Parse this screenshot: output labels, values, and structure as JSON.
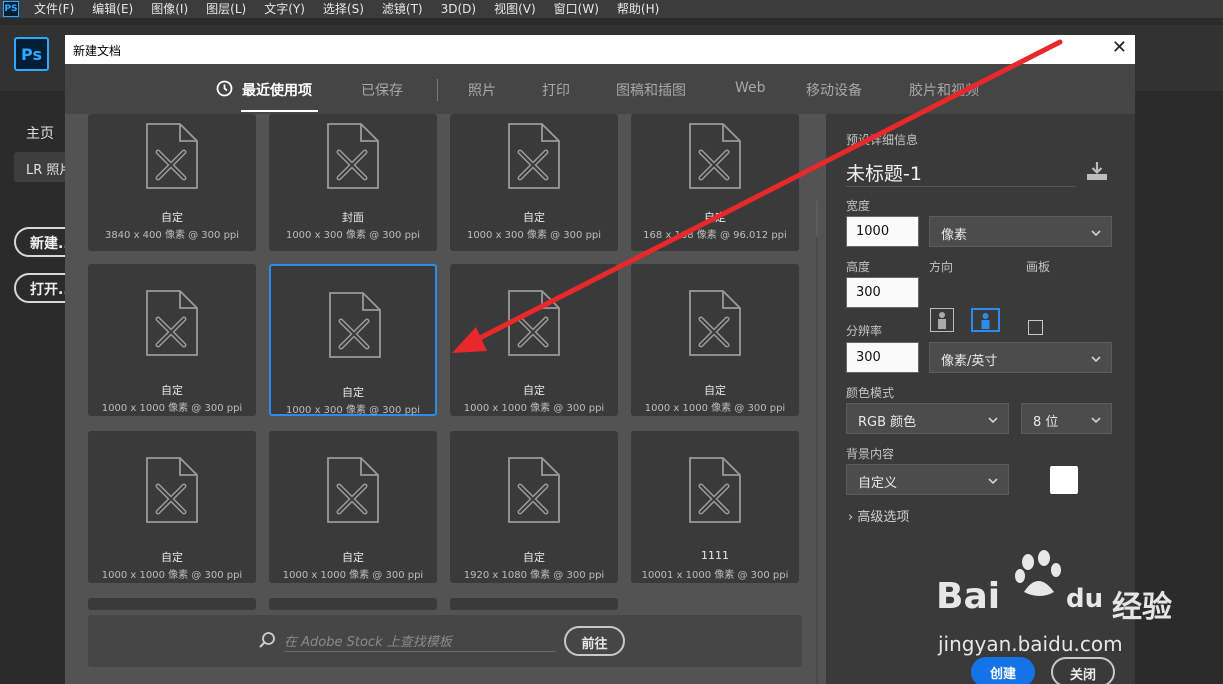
{
  "menubar": {
    "app_icon": "PS",
    "items": [
      "文件(F)",
      "编辑(E)",
      "图像(I)",
      "图层(L)",
      "文字(Y)",
      "选择(S)",
      "滤镜(T)",
      "3D(D)",
      "视图(V)",
      "窗口(W)",
      "帮助(H)"
    ]
  },
  "home": {
    "logo": "Ps",
    "nav_home": "主页",
    "nav_lr": "LR 照片",
    "new_button": "新建...",
    "open_button": "打开..."
  },
  "dialog": {
    "title": "新建文档",
    "close_glyph": "✕",
    "tabs": [
      "最近使用项",
      "已保存",
      "照片",
      "打印",
      "图稿和插图",
      "Web",
      "移动设备",
      "胶片和视频"
    ],
    "active_tab": 0,
    "cards": [
      {
        "name": "自定",
        "dims": "3840 x 400 像素 @ 300 ppi"
      },
      {
        "name": "封面",
        "dims": "1000 x 300 像素 @ 300 ppi"
      },
      {
        "name": "自定",
        "dims": "1000 x 300 像素 @ 300 ppi"
      },
      {
        "name": "自定",
        "dims": "168 x 168 像素 @ 96.012 ppi"
      },
      {
        "name": "自定",
        "dims": "1000 x 1000 像素 @ 300 ppi"
      },
      {
        "name": "自定",
        "dims": "1000 x 300 像素 @ 300 ppi"
      },
      {
        "name": "自定",
        "dims": "1000 x 1000 像素 @ 300 ppi"
      },
      {
        "name": "自定",
        "dims": "1000 x 1000 像素 @ 300 ppi"
      },
      {
        "name": "自定",
        "dims": "1000 x 1000 像素 @ 300 ppi"
      },
      {
        "name": "自定",
        "dims": "1000 x 1000 像素 @ 300 ppi"
      },
      {
        "name": "自定",
        "dims": "1920 x 1080 像素 @ 300 ppi"
      },
      {
        "name": "1111",
        "dims": "10001 x 1000 像素 @ 300 ppi"
      }
    ],
    "selected_card": 5,
    "stock": {
      "placeholder": "在 Adobe Stock 上查找模板",
      "go_button": "前往"
    },
    "preset": {
      "section_label": "预设详细信息",
      "doc_name": "未标题-1",
      "width_label": "宽度",
      "width_value": "1000",
      "width_unit": "像素",
      "height_label": "高度",
      "height_value": "300",
      "orientation_label": "方向",
      "artboard_label": "画板",
      "resolution_label": "分辨率",
      "resolution_value": "300",
      "resolution_unit": "像素/英寸",
      "color_mode_label": "颜色模式",
      "color_mode": "RGB 颜色",
      "bit_depth": "8 位",
      "background_label": "背景内容",
      "background": "自定义",
      "background_color": "#ffffff",
      "advanced": "高级选项",
      "create_button": "创建",
      "close_button": "关闭"
    }
  },
  "watermark": {
    "brand": "Bai",
    "brand_suffix": "du",
    "site_cn": "经验",
    "url": "jingyan.baidu.com"
  },
  "colors": {
    "accent_blue": "#2d8ceb",
    "annotation_red": "#e8282a"
  }
}
